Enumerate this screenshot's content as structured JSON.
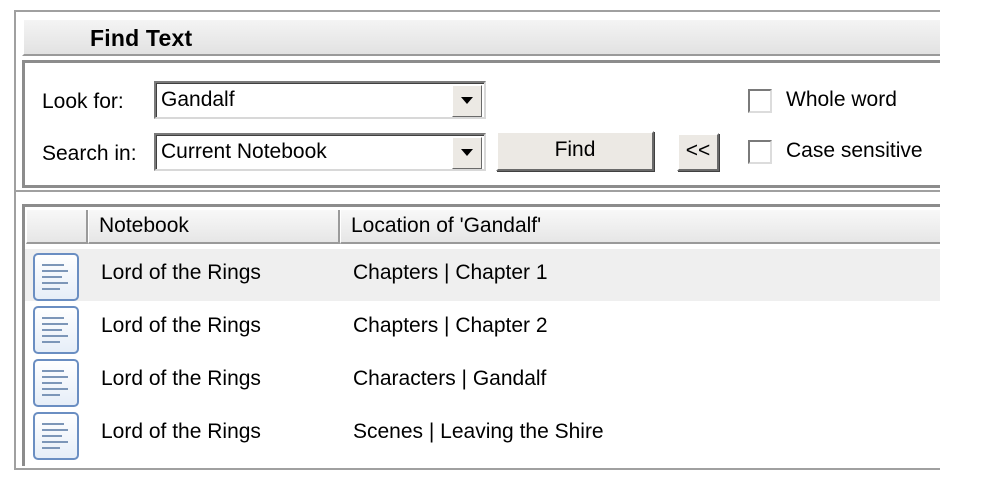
{
  "window": {
    "title": "Find Text"
  },
  "search": {
    "look_for_label": "Look for:",
    "look_for_value": "Gandalf",
    "search_in_label": "Search in:",
    "search_in_value": "Current Notebook",
    "find_button": "Find",
    "collapse_button": "<<",
    "whole_word_label": "Whole word",
    "whole_word_checked": false,
    "case_sensitive_label": "Case sensitive",
    "case_sensitive_checked": false
  },
  "results": {
    "columns": [
      "",
      "Notebook",
      "Location of 'Gandalf'"
    ],
    "rows": [
      {
        "icon": "page-icon",
        "notebook": "Lord of the Rings",
        "location": "Chapters | Chapter 1",
        "selected": true
      },
      {
        "icon": "page-icon",
        "notebook": "Lord of the Rings",
        "location": "Chapters | Chapter 2",
        "selected": false
      },
      {
        "icon": "page-icon",
        "notebook": "Lord of the Rings",
        "location": "Characters | Gandalf",
        "selected": false
      },
      {
        "icon": "page-icon",
        "notebook": "Lord of the Rings",
        "location": "Scenes | Leaving the Shire",
        "selected": false
      }
    ]
  }
}
